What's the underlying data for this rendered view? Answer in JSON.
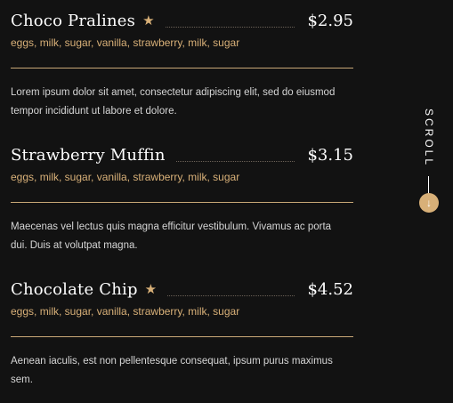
{
  "menu": {
    "items": [
      {
        "name": "Choco Pralines",
        "featured": true,
        "price": "$2.95",
        "ingredients": "eggs, milk, sugar, vanilla, strawberry, milk, sugar",
        "description": "Lorem ipsum dolor sit amet, consectetur adipiscing elit, sed do eiusmod tempor incididunt ut labore et dolore."
      },
      {
        "name": "Strawberry Muffin",
        "featured": false,
        "price": "$3.15",
        "ingredients": "eggs, milk, sugar, vanilla, strawberry, milk, sugar",
        "description": "Maecenas vel lectus quis magna efficitur vestibulum. Vivamus ac porta dui. Duis at volutpat magna."
      },
      {
        "name": "Chocolate Chip",
        "featured": true,
        "price": "$4.52",
        "ingredients": "eggs, milk, sugar, vanilla, strawberry, milk, sugar",
        "description": "Aenean iaculis, est non pellentesque consequat, ipsum purus maximus sem."
      }
    ]
  },
  "scroll": {
    "label": "SCROLL",
    "icon": "arrow-down-icon"
  },
  "colors": {
    "background": "#121212",
    "accent": "#d8b078",
    "text": "#ffffff",
    "muted_text": "#d5d5d5"
  }
}
